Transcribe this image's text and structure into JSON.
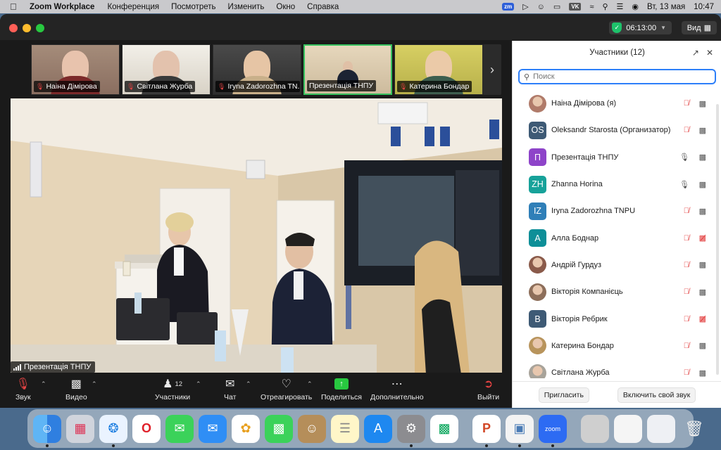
{
  "menubar": {
    "app_name": "Zoom Workplace",
    "items": [
      "Конференция",
      "Посмотреть",
      "Изменить",
      "Окно",
      "Справка"
    ],
    "zm_badge": "zm",
    "vk_badge": "VK",
    "datetime": "Вт, 13 мая",
    "clock": "10:47"
  },
  "titlebar": {
    "timer": "06:13:00",
    "view_label": "Вид"
  },
  "thumbnails": [
    {
      "name": "Наіна Дімірова",
      "muted": true
    },
    {
      "name": "Світлана Журба",
      "muted": true
    },
    {
      "name": "Iryna Zadorozhna TN...",
      "muted": true
    },
    {
      "name": "Презентація ТНПУ",
      "muted": false
    },
    {
      "name": "Катерина Бондар",
      "muted": true
    }
  ],
  "main_video": {
    "label": "Презентація ТНПУ"
  },
  "toolbar": {
    "audio_label": "Звук",
    "video_label": "Видео",
    "participants_label": "Участники",
    "participants_count": "12",
    "chat_label": "Чат",
    "react_label": "Отреагировать",
    "share_label": "Поделиться",
    "more_label": "Дополнительно",
    "leave_label": "Выйти"
  },
  "panel": {
    "title": "Участники (12)",
    "search_placeholder": "Поиск",
    "participants": [
      {
        "name": "Наіна Дімірова (я)",
        "avatar": "photo",
        "color": "#b07b6a",
        "mic": "muted",
        "cam": "on"
      },
      {
        "name": "Oleksandr Starosta (Организатор)",
        "avatar": "OS",
        "color": "#3e5a75",
        "mic": "muted",
        "cam": "on"
      },
      {
        "name": "Презентація ТНПУ",
        "avatar": "П",
        "color": "#8e44c9",
        "mic": "on",
        "cam": "on"
      },
      {
        "name": "Zhanna Horina",
        "avatar": "ZH",
        "color": "#17a29a",
        "mic": "on",
        "cam": "on"
      },
      {
        "name": "Iryna Zadorozhna TNPU",
        "avatar": "IZ",
        "color": "#2f7fb8",
        "mic": "muted",
        "cam": "on"
      },
      {
        "name": "Алла Боднар",
        "avatar": "A",
        "color": "#0e8f98",
        "mic": "muted",
        "cam": "off"
      },
      {
        "name": "Андрій Гурдуз",
        "avatar": "photo",
        "color": "#8a5a4a",
        "mic": "muted",
        "cam": "on"
      },
      {
        "name": "Вікторія Компанієць",
        "avatar": "photo",
        "color": "#8d6e5a",
        "mic": "muted",
        "cam": "on"
      },
      {
        "name": "Вікторія Ребрик",
        "avatar": "B",
        "color": "#3e5a75",
        "mic": "muted",
        "cam": "off"
      },
      {
        "name": "Катерина Бондар",
        "avatar": "photo",
        "color": "#b8945c",
        "mic": "muted",
        "cam": "on"
      },
      {
        "name": "Світлана Журба",
        "avatar": "photo",
        "color": "#a8a39a",
        "mic": "muted",
        "cam": "on"
      }
    ],
    "invite_label": "Пригласить",
    "unmute_label": "Включить свой звук"
  },
  "dock": {
    "apps": [
      "finder-icon",
      "launchpad-icon",
      "safari-icon",
      "opera-icon",
      "messages-icon",
      "mail-icon",
      "photos-icon",
      "facetime-icon",
      "contacts-icon",
      "notes-icon",
      "appstore-icon",
      "settings-icon",
      "meet-icon",
      "powerpoint-icon",
      "preview-icon",
      "zoom-icon"
    ],
    "zoom_text": "zoom"
  }
}
